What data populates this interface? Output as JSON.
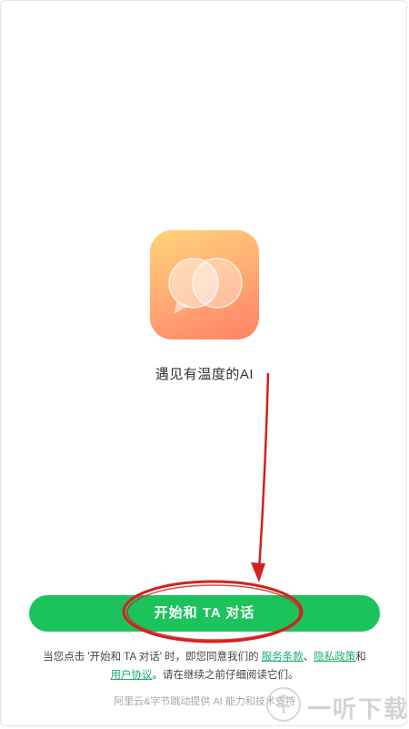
{
  "tagline": "遇见有温度的AI",
  "start_button": {
    "label": "开始和 TA 对话"
  },
  "consent": {
    "prefix": "当您点击 '开始和 TA 对话' 时，即您同意我们的 ",
    "terms_link": "服务条款",
    "separator": "、",
    "privacy_link": "隐私政策",
    "and": "和",
    "agreement_link": "用户协议",
    "suffix": "。请在继续之前仔细阅读它们。"
  },
  "powered_by": "阿里云&字节跳动提供 AI 能力和技术支持",
  "watermark": {
    "text": "一听下载"
  },
  "colors": {
    "accent": "#1cc35c",
    "link": "#1aad6a",
    "annotation": "#d61f1f"
  }
}
